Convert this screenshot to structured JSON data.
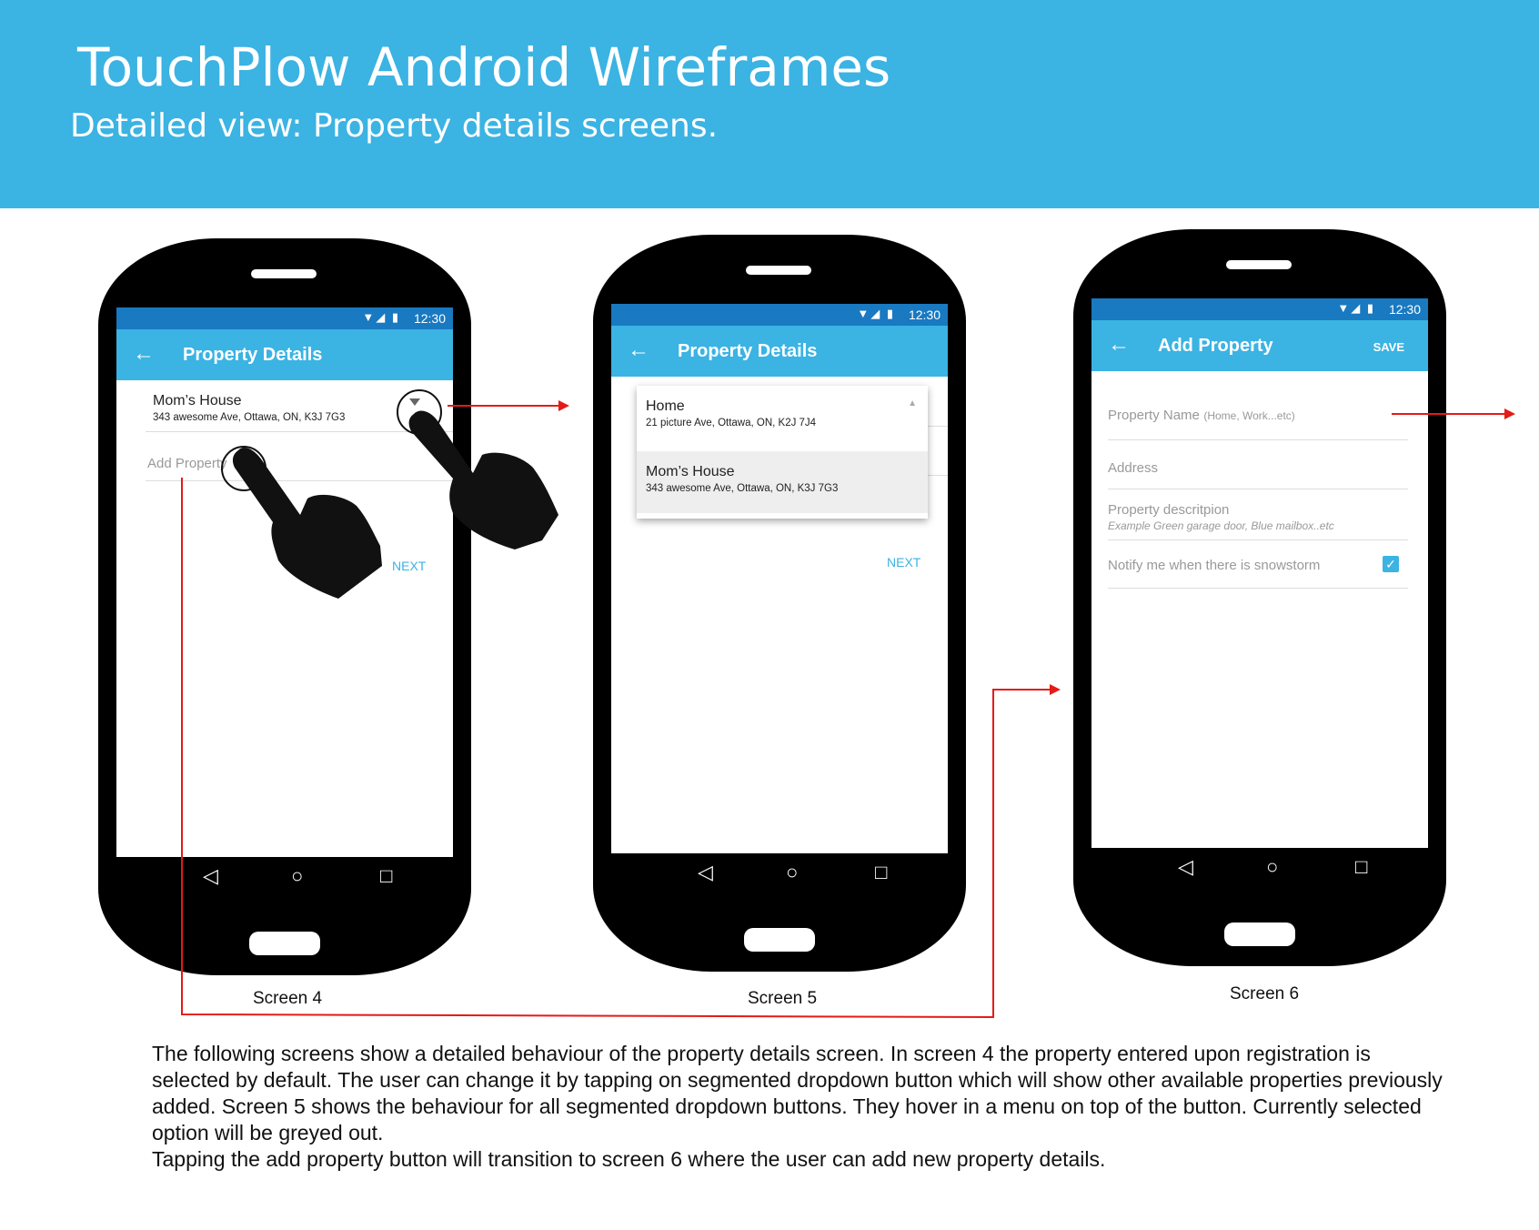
{
  "header": {
    "title": "TouchPlow Android Wireframes",
    "subtitle": "Detailed view: Property details screens."
  },
  "status": {
    "time": "12:30",
    "icons": "▼◢ ▮"
  },
  "nav": {
    "back": "◁",
    "home": "○",
    "recent": "□"
  },
  "screen4": {
    "app_title": "Property Details",
    "selected_name": "Mom’s House",
    "selected_address": "343 awesome Ave, Ottawa, ON, K3J 7G3",
    "add_property": "Add Property",
    "next": "NEXT",
    "caption": "Screen 4"
  },
  "screen5": {
    "app_title": "Property Details",
    "options": [
      {
        "name": "Home",
        "address": "21 picture Ave, Ottawa, ON, K2J 7J4"
      },
      {
        "name": "Mom’s House",
        "address": "343 awesome Ave, Ottawa, ON, K3J 7G3"
      }
    ],
    "next": "NEXT",
    "caption": "Screen 5"
  },
  "screen6": {
    "app_title": "Add Property",
    "save": "SAVE",
    "property_name_label": "Property Name",
    "property_name_hint": "(Home, Work...etc)",
    "address_label": "Address",
    "description_label": "Property descritpion",
    "description_example": "Example Green garage door, Blue mailbox..etc",
    "notify_label": "Notify me when there is snowstorm",
    "notify_checked": true,
    "caption": "Screen 6"
  },
  "description": {
    "paragraph1": "The following screens show a detailed behaviour of the property details screen.  In screen 4 the property entered upon registration is selected by default. The user can change it by tapping on segmented dropdown button which will show other available properties previously added. Screen 5 shows the behaviour for all segmented dropdown buttons. They hover in a menu on top of the button.  Currently selected option will be greyed out.",
    "paragraph2": "Tapping the add property button will transition to screen 6 where the user can add new property details."
  },
  "colors": {
    "accent": "#3bb3e3",
    "statusbar": "#1979c1",
    "arrow": "#e41b17"
  }
}
